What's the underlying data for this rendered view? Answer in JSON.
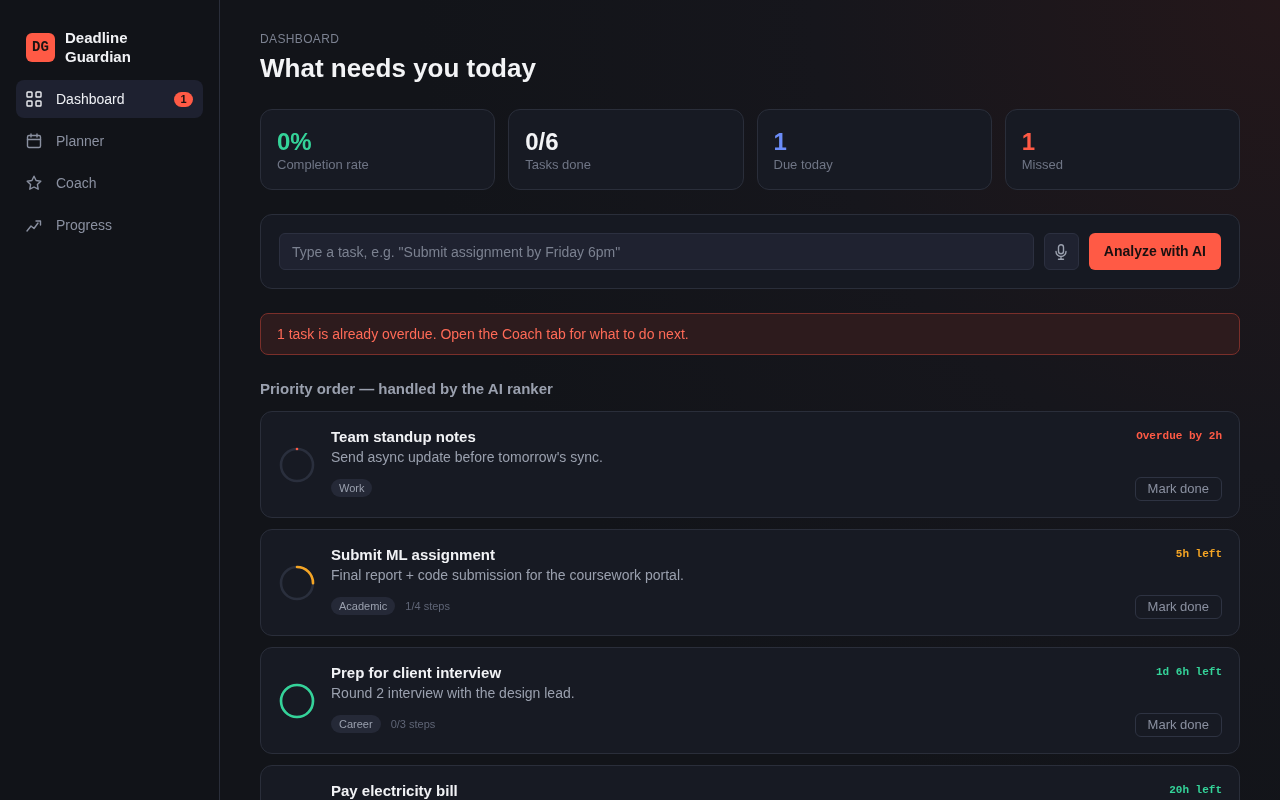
{
  "app": {
    "logo": "DG",
    "name": "Deadline Guardian"
  },
  "nav": [
    {
      "label": "Dashboard",
      "kind": "grid",
      "selected": true,
      "badge": "1"
    },
    {
      "label": "Planner",
      "kind": "calendar",
      "selected": false
    },
    {
      "label": "Coach",
      "kind": "star",
      "selected": false
    },
    {
      "label": "Progress",
      "kind": "trend",
      "selected": false
    }
  ],
  "header": {
    "eyebrow": "DASHBOARD",
    "title": "What needs you today"
  },
  "stats": [
    {
      "value": "0%",
      "label": "Completion rate",
      "color": "#34d399"
    },
    {
      "value": "0/6",
      "label": "Tasks done",
      "color": "#f3f4f6"
    },
    {
      "value": "1",
      "label": "Due today",
      "color": "#6b8cf7"
    },
    {
      "value": "1",
      "label": "Missed",
      "color": "#ff5a45"
    }
  ],
  "task_input": {
    "placeholder": "Type a task, e.g. \"Submit assignment by Friday 6pm\"",
    "submit": "Analyze with AI"
  },
  "alert": "1 task is already overdue. Open the Coach tab for what to do next.",
  "section_title": "Priority order — handled by the AI ranker",
  "tasks": [
    {
      "title": "Team standup notes",
      "description": "Send async update before tomorrow's sync.",
      "tag": "Work",
      "time_left": "Overdue by 2h",
      "color": "#ff5a45",
      "level": 0,
      "action": "Mark done"
    },
    {
      "title": "Submit ML assignment",
      "description": "Final report + code submission for the coursework portal.",
      "tag": "Academic",
      "steps": "1/4 steps",
      "time_left": "5h left",
      "color": "#f5a524",
      "level": 0.25,
      "action": "Mark done"
    },
    {
      "title": "Prep for client interview",
      "description": "Round 2 interview with the design lead.",
      "tag": "Career",
      "steps": "0/3 steps",
      "time_left": "1d 6h left",
      "color": "#34d399",
      "level": 1,
      "action": "Mark done"
    },
    {
      "title": "Pay electricity bill",
      "time_left": "20h left",
      "color": "#34d399"
    }
  ]
}
